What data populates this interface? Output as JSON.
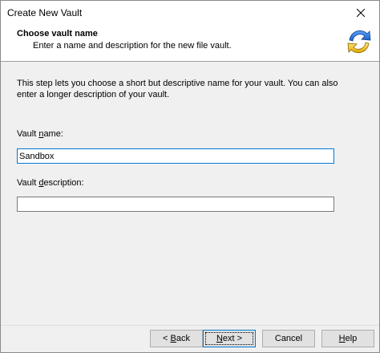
{
  "window": {
    "title": "Create New Vault"
  },
  "header": {
    "title": "Choose vault name",
    "subtitle": "Enter a name and description for the new file vault.",
    "icon": "refresh-arrows-icon"
  },
  "content": {
    "intro": "This step lets you choose a short but descriptive name for your vault. You can also enter a longer description of your vault.",
    "vault_name": {
      "label": "Vault name:",
      "value": "Sandbox"
    },
    "vault_description": {
      "label": "Vault description:",
      "value": ""
    }
  },
  "buttons": {
    "back": {
      "prefix": "< ",
      "mnemonic": "B",
      "rest": "ack"
    },
    "next": {
      "mnemonic": "N",
      "rest": "ext >"
    },
    "cancel": "Cancel",
    "help": {
      "mnemonic": "H",
      "rest": "elp"
    }
  },
  "colors": {
    "focus_border": "#0078d7",
    "icon_blue": "#2a6fdb",
    "icon_yellow": "#f5c400"
  }
}
